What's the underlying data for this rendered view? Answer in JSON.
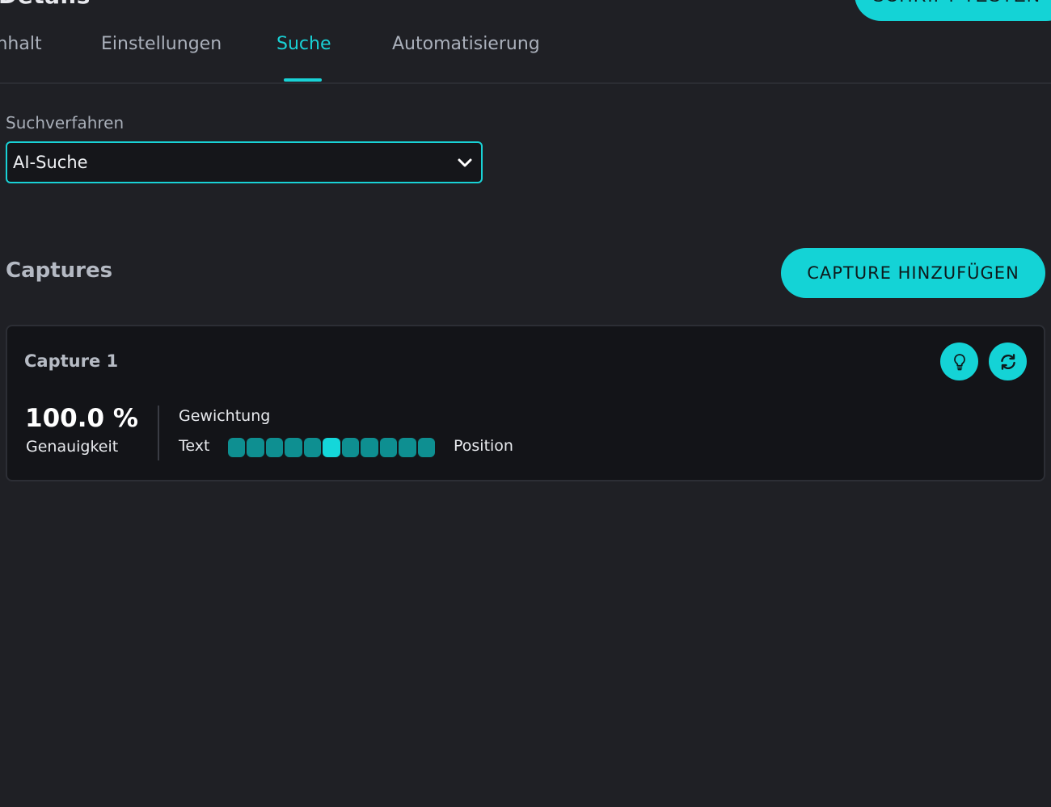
{
  "header": {
    "title": "Details",
    "action_label": "SCHRIFT TESTEN"
  },
  "tabs": [
    {
      "label": "Inhalt",
      "active": false
    },
    {
      "label": "Einstellungen",
      "active": false
    },
    {
      "label": "Suche",
      "active": true
    },
    {
      "label": "Automatisierung",
      "active": false
    }
  ],
  "search": {
    "label": "Suchverfahren",
    "selected": "AI-Suche"
  },
  "captures": {
    "title": "Captures",
    "add_label": "CAPTURE HINZUFÜGEN",
    "items": [
      {
        "name": "Capture 1",
        "accuracy": "100.0 %",
        "accuracy_label": "Genauigkeit",
        "weight_label": "Gewichtung",
        "weight_left": "Text",
        "weight_right": "Position",
        "weight_steps": 11,
        "weight_selected_step": 6
      }
    ]
  },
  "icons": {
    "hint": "lightbulb-icon",
    "refresh": "refresh-icon",
    "chevron": "chevron-down-icon"
  },
  "colors": {
    "accent": "#14d3d6",
    "background": "#1f2025",
    "card": "#131418",
    "slider_step": "#0e8f91"
  }
}
